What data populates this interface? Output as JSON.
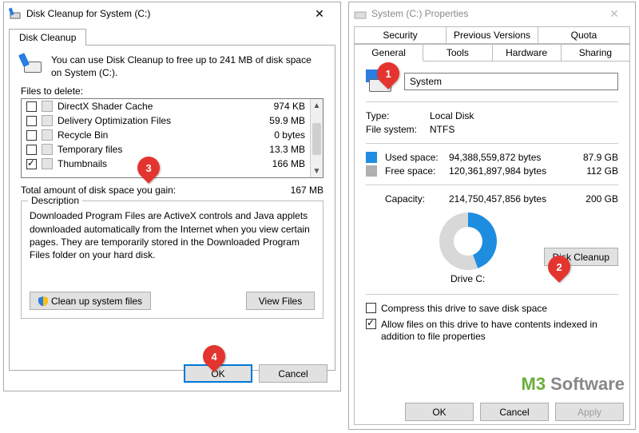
{
  "cleanup": {
    "title": "Disk Cleanup for System (C:)",
    "tab": "Disk Cleanup",
    "intro": "You can use Disk Cleanup to free up to 241 MB of disk space on System (C:).",
    "files_label": "Files to delete:",
    "items": [
      {
        "name": "DirectX Shader Cache",
        "size": "974 KB",
        "checked": false
      },
      {
        "name": "Delivery Optimization Files",
        "size": "59.9 MB",
        "checked": false
      },
      {
        "name": "Recycle Bin",
        "size": "0 bytes",
        "checked": false
      },
      {
        "name": "Temporary files",
        "size": "13.3 MB",
        "checked": false
      },
      {
        "name": "Thumbnails",
        "size": "166 MB",
        "checked": true
      }
    ],
    "total_label": "Total amount of disk space you gain:",
    "total_value": "167 MB",
    "desc_label": "Description",
    "desc_text": "Downloaded Program Files are ActiveX controls and Java applets downloaded automatically from the Internet when you view certain pages. They are temporarily stored in the Downloaded Program Files folder on your hard disk.",
    "btn_sys": "Clean up system files",
    "btn_view": "View Files",
    "btn_ok": "OK",
    "btn_cancel": "Cancel"
  },
  "props": {
    "title": "System (C:) Properties",
    "tabs_row1": [
      "Security",
      "Previous Versions",
      "Quota"
    ],
    "tabs_row2": [
      "General",
      "Tools",
      "Hardware",
      "Sharing"
    ],
    "name_value": "System",
    "type_k": "Type:",
    "type_v": "Local Disk",
    "fs_k": "File system:",
    "fs_v": "NTFS",
    "used_k": "Used space:",
    "used_bytes": "94,388,559,872 bytes",
    "used_gb": "87.9 GB",
    "free_k": "Free space:",
    "free_bytes": "120,361,897,984 bytes",
    "free_gb": "112 GB",
    "cap_k": "Capacity:",
    "cap_bytes": "214,750,457,856 bytes",
    "cap_gb": "200 GB",
    "drive_label": "Drive C:",
    "btn_cleanup": "Disk Cleanup",
    "chk_compress": "Compress this drive to save disk space",
    "chk_index": "Allow files on this drive to have contents indexed in addition to file properties",
    "btn_ok": "OK",
    "btn_cancel": "Cancel",
    "btn_apply": "Apply"
  },
  "markers": {
    "m1": "1",
    "m2": "2",
    "m3": "3",
    "m4": "4"
  },
  "watermark": {
    "a": "M3",
    "b": "Software"
  }
}
